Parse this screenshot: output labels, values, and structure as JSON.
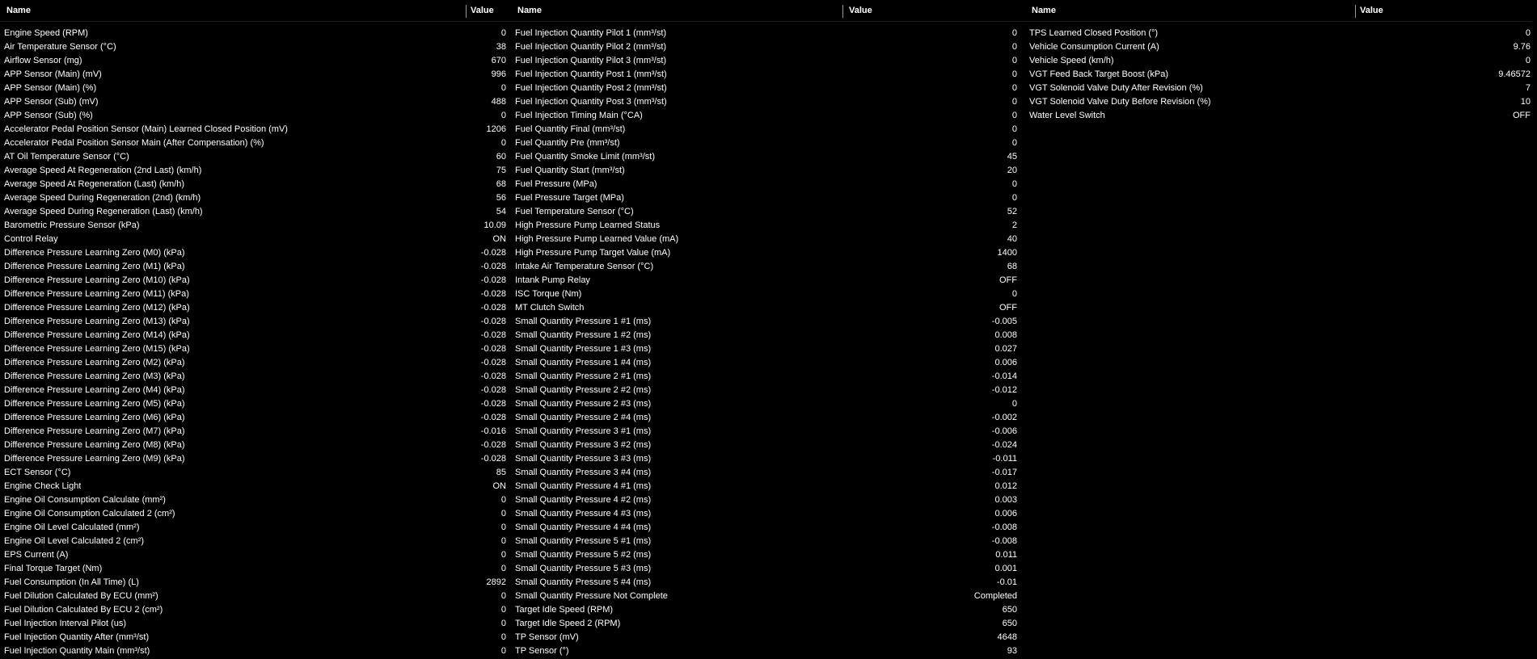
{
  "headers": {
    "name": "Name",
    "value": "Value"
  },
  "panels": [
    {
      "rows": [
        {
          "name": "Engine Speed (RPM)",
          "value": "0"
        },
        {
          "name": "Air Temperature Sensor (°C)",
          "value": "38"
        },
        {
          "name": "Airflow Sensor (mg)",
          "value": "670"
        },
        {
          "name": "APP Sensor (Main) (mV)",
          "value": "996"
        },
        {
          "name": "APP Sensor (Main) (%)",
          "value": "0"
        },
        {
          "name": "APP Sensor (Sub) (mV)",
          "value": "488"
        },
        {
          "name": "APP Sensor (Sub) (%)",
          "value": "0"
        },
        {
          "name": "Accelerator Pedal Position Sensor (Main) Learned Closed Position (mV)",
          "value": "1206"
        },
        {
          "name": "Accelerator Pedal Position Sensor Main (After Compensation) (%)",
          "value": "0"
        },
        {
          "name": "AT Oil Temperature Sensor (°C)",
          "value": "60"
        },
        {
          "name": "Average Speed At Regeneration (2nd Last) (km/h)",
          "value": "75"
        },
        {
          "name": "Average Speed At Regeneration (Last) (km/h)",
          "value": "68"
        },
        {
          "name": "Average Speed During Regeneration (2nd) (km/h)",
          "value": "56"
        },
        {
          "name": "Average Speed During Regeneration (Last) (km/h)",
          "value": "54"
        },
        {
          "name": "Barometric Pressure Sensor (kPa)",
          "value": "10.09"
        },
        {
          "name": "Control Relay",
          "value": "ON"
        },
        {
          "name": "Difference Pressure Learning Zero (M0) (kPa)",
          "value": "-0.028"
        },
        {
          "name": "Difference Pressure Learning Zero (M1) (kPa)",
          "value": "-0.028"
        },
        {
          "name": "Difference Pressure Learning Zero (M10) (kPa)",
          "value": "-0.028"
        },
        {
          "name": "Difference Pressure Learning Zero (M11) (kPa)",
          "value": "-0.028"
        },
        {
          "name": "Difference Pressure Learning Zero (M12) (kPa)",
          "value": "-0.028"
        },
        {
          "name": "Difference Pressure Learning Zero (M13) (kPa)",
          "value": "-0.028"
        },
        {
          "name": "Difference Pressure Learning Zero (M14) (kPa)",
          "value": "-0.028"
        },
        {
          "name": "Difference Pressure Learning Zero (M15) (kPa)",
          "value": "-0.028"
        },
        {
          "name": "Difference Pressure Learning Zero (M2) (kPa)",
          "value": "-0.028"
        },
        {
          "name": "Difference Pressure Learning Zero (M3) (kPa)",
          "value": "-0.028"
        },
        {
          "name": "Difference Pressure Learning Zero (M4) (kPa)",
          "value": "-0.028"
        },
        {
          "name": "Difference Pressure Learning Zero (M5) (kPa)",
          "value": "-0.028"
        },
        {
          "name": "Difference Pressure Learning Zero (M6) (kPa)",
          "value": "-0.028"
        },
        {
          "name": "Difference Pressure Learning Zero (M7) (kPa)",
          "value": "-0.016"
        },
        {
          "name": "Difference Pressure Learning Zero (M8) (kPa)",
          "value": "-0.028"
        },
        {
          "name": "Difference Pressure Learning Zero (M9) (kPa)",
          "value": "-0.028"
        },
        {
          "name": "ECT Sensor (°C)",
          "value": "85"
        },
        {
          "name": "Engine Check Light",
          "value": "ON"
        },
        {
          "name": "Engine Oil Consumption Calculate (mm²)",
          "value": "0"
        },
        {
          "name": "Engine Oil Consumption Calculated 2 (cm²)",
          "value": "0"
        },
        {
          "name": "Engine Oil Level Calculated (mm²)",
          "value": "0"
        },
        {
          "name": "Engine Oil Level Calculated 2 (cm²)",
          "value": "0"
        },
        {
          "name": "EPS Current (A)",
          "value": "0"
        },
        {
          "name": "Final Torque Target (Nm)",
          "value": "0"
        },
        {
          "name": "Fuel Consumption (In All Time) (L)",
          "value": "2892"
        },
        {
          "name": "Fuel Dilution Calculated By ECU (mm²)",
          "value": "0"
        },
        {
          "name": "Fuel Dilution Calculated By ECU 2 (cm²)",
          "value": "0"
        },
        {
          "name": "Fuel Injection Interval Pilot (us)",
          "value": "0"
        },
        {
          "name": "Fuel Injection Quantity After (mm³/st)",
          "value": "0"
        },
        {
          "name": "Fuel Injection Quantity Main (mm³/st)",
          "value": "0"
        }
      ]
    },
    {
      "rows": [
        {
          "name": "Fuel Injection Quantity Pilot 1 (mm³/st)",
          "value": "0"
        },
        {
          "name": "Fuel Injection Quantity Pilot 2 (mm³/st)",
          "value": "0"
        },
        {
          "name": "Fuel Injection Quantity Pilot 3 (mm³/st)",
          "value": "0"
        },
        {
          "name": "Fuel Injection Quantity Post 1 (mm³/st)",
          "value": "0"
        },
        {
          "name": "Fuel Injection Quantity Post 2 (mm³/st)",
          "value": "0"
        },
        {
          "name": "Fuel Injection Quantity Post 3 (mm³/st)",
          "value": "0"
        },
        {
          "name": "Fuel Injection Timing Main (°CA)",
          "value": "0"
        },
        {
          "name": "Fuel Quantity Final (mm³/st)",
          "value": "0"
        },
        {
          "name": "Fuel Quantity Pre (mm³/st)",
          "value": "0"
        },
        {
          "name": "Fuel Quantity Smoke Limit (mm³/st)",
          "value": "45"
        },
        {
          "name": "Fuel Quantity Start (mm³/st)",
          "value": "20"
        },
        {
          "name": "Fuel Pressure (MPa)",
          "value": "0"
        },
        {
          "name": "Fuel Pressure Target (MPa)",
          "value": "0"
        },
        {
          "name": "Fuel Temperature Sensor (°C)",
          "value": "52"
        },
        {
          "name": "High Pressure Pump Learned Status",
          "value": "2"
        },
        {
          "name": "High Pressure Pump Learned Value (mA)",
          "value": "40"
        },
        {
          "name": "High Pressure Pump Target Value (mA)",
          "value": "1400"
        },
        {
          "name": "Intake Air Temperature Sensor (°C)",
          "value": "68"
        },
        {
          "name": "Intank Pump Relay",
          "value": "OFF"
        },
        {
          "name": "ISC Torque (Nm)",
          "value": "0"
        },
        {
          "name": "MT Clutch Switch",
          "value": "OFF"
        },
        {
          "name": "Small Quantity Pressure 1 #1 (ms)",
          "value": "-0.005"
        },
        {
          "name": "Small Quantity Pressure 1 #2 (ms)",
          "value": "0.008"
        },
        {
          "name": "Small Quantity Pressure 1 #3 (ms)",
          "value": "0.027"
        },
        {
          "name": "Small Quantity Pressure 1 #4 (ms)",
          "value": "0.006"
        },
        {
          "name": "Small Quantity Pressure 2 #1 (ms)",
          "value": "-0.014"
        },
        {
          "name": "Small Quantity Pressure 2 #2 (ms)",
          "value": "-0.012"
        },
        {
          "name": "Small Quantity Pressure 2 #3 (ms)",
          "value": "0"
        },
        {
          "name": "Small Quantity Pressure 2 #4 (ms)",
          "value": "-0.002"
        },
        {
          "name": "Small Quantity Pressure 3 #1 (ms)",
          "value": "-0.006"
        },
        {
          "name": "Small Quantity Pressure 3 #2 (ms)",
          "value": "-0.024"
        },
        {
          "name": "Small Quantity Pressure 3 #3 (ms)",
          "value": "-0.011"
        },
        {
          "name": "Small Quantity Pressure 3 #4 (ms)",
          "value": "-0.017"
        },
        {
          "name": "Small Quantity Pressure 4 #1 (ms)",
          "value": "0.012"
        },
        {
          "name": "Small Quantity Pressure 4 #2 (ms)",
          "value": "0.003"
        },
        {
          "name": "Small Quantity Pressure 4 #3 (ms)",
          "value": "0.006"
        },
        {
          "name": "Small Quantity Pressure 4 #4 (ms)",
          "value": "-0.008"
        },
        {
          "name": "Small Quantity Pressure 5 #1 (ms)",
          "value": "-0.008"
        },
        {
          "name": "Small Quantity Pressure 5 #2 (ms)",
          "value": "0.011"
        },
        {
          "name": "Small Quantity Pressure 5 #3 (ms)",
          "value": "0.001"
        },
        {
          "name": "Small Quantity Pressure 5 #4 (ms)",
          "value": "-0.01"
        },
        {
          "name": "Small Quantity Pressure Not Complete",
          "value": "Completed"
        },
        {
          "name": "Target Idle Speed (RPM)",
          "value": "650"
        },
        {
          "name": "Target Idle Speed 2 (RPM)",
          "value": "650"
        },
        {
          "name": "TP Sensor (mV)",
          "value": "4648"
        },
        {
          "name": "TP Sensor (°)",
          "value": "93"
        }
      ]
    },
    {
      "rows": [
        {
          "name": "TPS Learned Closed Position (°)",
          "value": "0"
        },
        {
          "name": "Vehicle Consumption Current (A)",
          "value": "9.76"
        },
        {
          "name": "Vehicle Speed (km/h)",
          "value": "0"
        },
        {
          "name": "VGT Feed Back Target Boost (kPa)",
          "value": "9.46572"
        },
        {
          "name": "VGT Solenoid Valve Duty After Revision (%)",
          "value": "7"
        },
        {
          "name": "VGT Solenoid Valve Duty Before Revision (%)",
          "value": "10"
        },
        {
          "name": "Water Level Switch",
          "value": "OFF"
        }
      ]
    }
  ]
}
